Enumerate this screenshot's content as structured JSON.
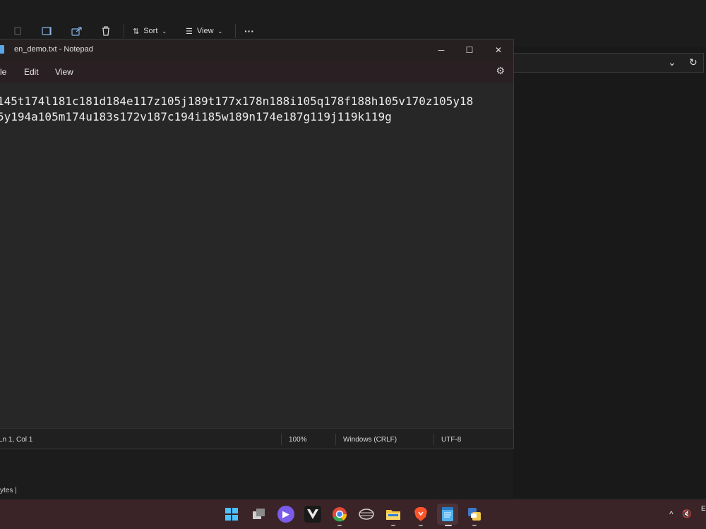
{
  "explorer": {
    "toolbar": {
      "sort_label": "Sort",
      "view_label": "View",
      "more_label": "···"
    },
    "status_bytes": "ytes  |"
  },
  "notepad": {
    "title": "en_demo.txt - Notepad",
    "menu": [
      "le",
      "Edit",
      "View"
    ],
    "lines": [
      "145t174l181c181d184e117z105j189t177x178n188i105q178f188h105v170z105y18",
      "5y194a105m174u183s172v187c194i185w189n174e187g119j119k119g"
    ],
    "status": {
      "position": "Ln 1, Col 1",
      "zoom": "100%",
      "line_ending": "Windows (CRLF)",
      "encoding": "UTF-8"
    }
  },
  "taskbar": {
    "tray_chevron": "^",
    "tray_volume": "🔇",
    "tray_lang": "E"
  }
}
